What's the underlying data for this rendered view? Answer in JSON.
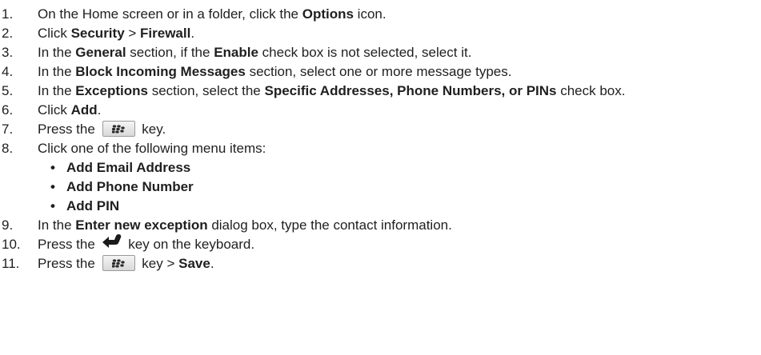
{
  "steps": [
    {
      "num": "1.",
      "parts": [
        {
          "t": "On the Home screen or in a folder, click the "
        },
        {
          "t": "Options",
          "b": true
        },
        {
          "t": " icon."
        }
      ]
    },
    {
      "num": "2.",
      "parts": [
        {
          "t": "Click "
        },
        {
          "t": "Security",
          "b": true
        },
        {
          "t": " > "
        },
        {
          "t": "Firewall",
          "b": true
        },
        {
          "t": "."
        }
      ]
    },
    {
      "num": "3.",
      "parts": [
        {
          "t": "In the "
        },
        {
          "t": "General",
          "b": true
        },
        {
          "t": " section, if the "
        },
        {
          "t": "Enable",
          "b": true
        },
        {
          "t": " check box is not selected, select it."
        }
      ]
    },
    {
      "num": "4.",
      "parts": [
        {
          "t": "In the "
        },
        {
          "t": "Block Incoming Messages",
          "b": true
        },
        {
          "t": " section, select one or more message types."
        }
      ]
    },
    {
      "num": "5.",
      "parts": [
        {
          "t": "In the "
        },
        {
          "t": "Exceptions",
          "b": true
        },
        {
          "t": " section, select the "
        },
        {
          "t": "Specific Addresses, Phone Numbers, or PINs",
          "b": true
        },
        {
          "t": " check box."
        }
      ]
    },
    {
      "num": "6.",
      "parts": [
        {
          "t": "Click "
        },
        {
          "t": "Add",
          "b": true
        },
        {
          "t": "."
        }
      ]
    },
    {
      "num": "7.",
      "parts": [
        {
          "t": "Press the "
        },
        {
          "icon": "blackberry-menu-key-icon"
        },
        {
          "t": " key."
        }
      ]
    },
    {
      "num": "8.",
      "parts": [
        {
          "t": "Click one of the following menu items:"
        }
      ],
      "subitems": [
        "Add Email Address",
        "Add Phone Number",
        "Add PIN"
      ]
    },
    {
      "num": "9.",
      "parts": [
        {
          "t": "In the "
        },
        {
          "t": "Enter new exception",
          "b": true
        },
        {
          "t": " dialog box, type the contact information."
        }
      ]
    },
    {
      "num": "10.",
      "parts": [
        {
          "t": "Press the "
        },
        {
          "icon": "enter-key-icon"
        },
        {
          "t": " key on the keyboard."
        }
      ]
    },
    {
      "num": "11.",
      "parts": [
        {
          "t": "Press the "
        },
        {
          "icon": "blackberry-menu-key-icon"
        },
        {
          "t": " key > "
        },
        {
          "t": "Save",
          "b": true
        },
        {
          "t": "."
        }
      ]
    }
  ],
  "bullet_glyph": "•"
}
